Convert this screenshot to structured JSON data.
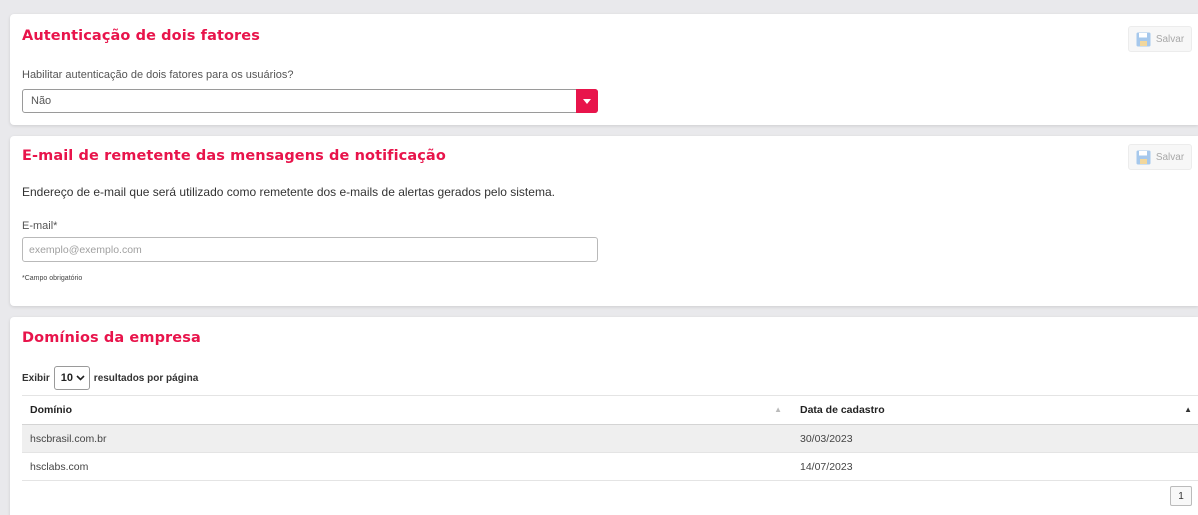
{
  "two_factor": {
    "title": "Autenticação de dois fatores",
    "save_label": "Salvar",
    "question": "Habilitar autenticação de dois fatores para os usuários?",
    "selected_value": "Não"
  },
  "sender_email": {
    "title": "E-mail de remetente das mensagens de notificação",
    "save_label": "Salvar",
    "description": "Endereço de e-mail que será utilizado como remetente dos e-mails de alertas gerados pelo sistema.",
    "field_label": "E-mail*",
    "placeholder": "exemplo@exemplo.com",
    "required_note": "*Campo obrigatório"
  },
  "domains": {
    "title": "Domínios da empresa",
    "length_prefix": "Exibir",
    "length_value": "10",
    "length_suffix": "resultados por página",
    "columns": [
      "Domínio",
      "Data de cadastro"
    ],
    "rows": [
      {
        "domain": "hscbrasil.com.br",
        "date": "30/03/2023"
      },
      {
        "domain": "hsclabs.com",
        "date": "14/07/2023"
      }
    ],
    "page": "1"
  },
  "colors": {
    "accent": "#e8144b",
    "save_icon": "#a6c8ec",
    "background": "#e9e9ec"
  },
  "icons": {
    "save": "floppy-disk-icon",
    "dropdown": "caret-down-icon",
    "sort_neutral": "sort-icon",
    "sort_asc": "sort-asc-icon"
  }
}
